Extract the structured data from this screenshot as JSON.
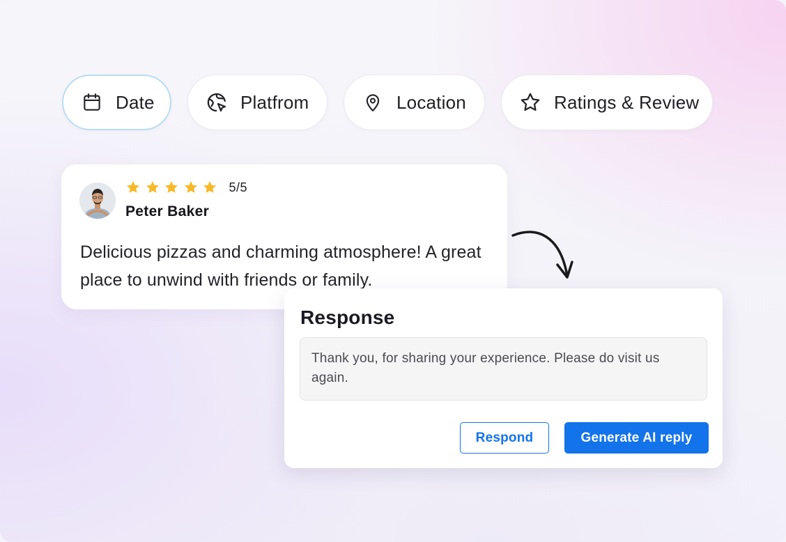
{
  "filters": [
    {
      "label": "Date",
      "icon": "calendar-icon",
      "active": true
    },
    {
      "label": "Platfrom",
      "icon": "globe-cursor-icon",
      "active": false
    },
    {
      "label": "Location",
      "icon": "location-pin-icon",
      "active": false
    },
    {
      "label": "Ratings & Review",
      "icon": "star-outline-icon",
      "active": false
    }
  ],
  "review": {
    "rating": "5/5",
    "rating_value": 5,
    "rating_max": 5,
    "reviewer_name": "Peter Baker",
    "text": "Delicious pizzas and charming atmosphere! A great place to unwind with friends or family."
  },
  "response": {
    "title": "Response",
    "text": "Thank you, for sharing your experience. Please do visit us again.",
    "respond_label": "Respond",
    "generate_label": "Generate AI reply"
  },
  "colors": {
    "accent": "#1273eb",
    "star": "#f7b928",
    "active_chip_border": "#b9dcf2"
  }
}
